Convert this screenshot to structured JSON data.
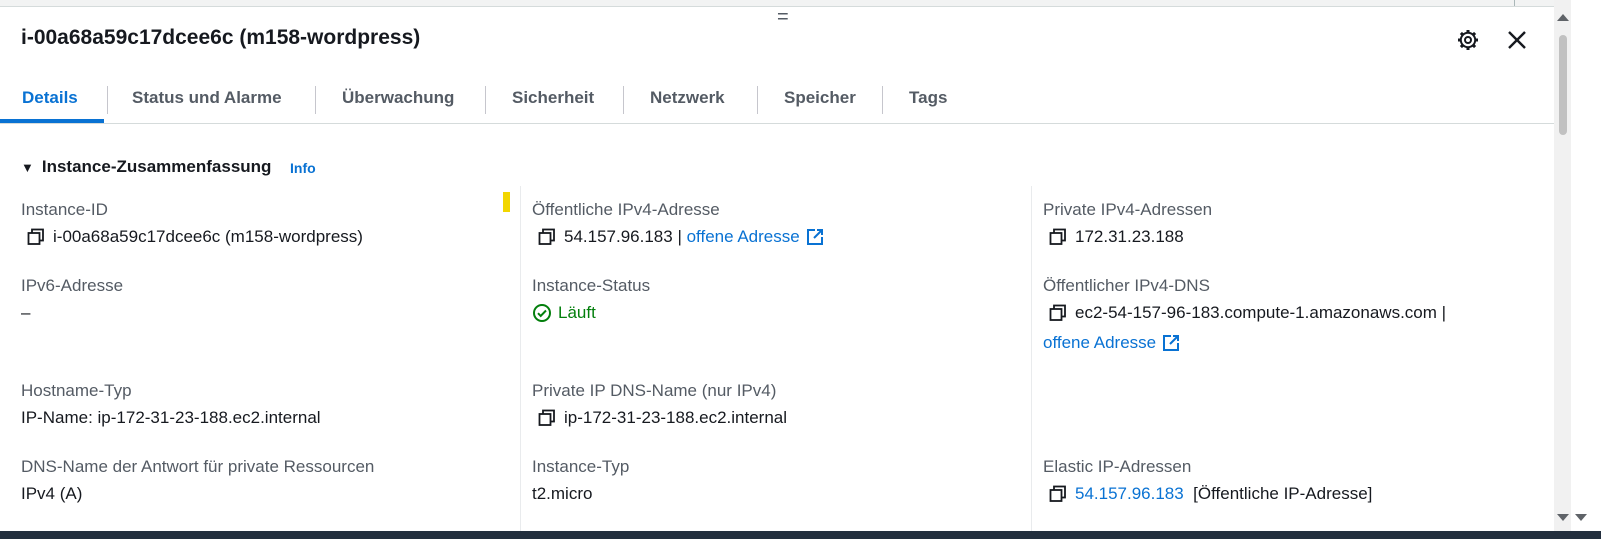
{
  "panel": {
    "title": "i-00a68a59c17dcee6c (m158-wordpress)",
    "drag_handle": "="
  },
  "tabs": [
    {
      "label": "Details"
    },
    {
      "label": "Status und Alarme"
    },
    {
      "label": "Überwachung"
    },
    {
      "label": "Sicherheit"
    },
    {
      "label": "Netzwerk"
    },
    {
      "label": "Speicher"
    },
    {
      "label": "Tags"
    }
  ],
  "section": {
    "title": "Instance-Zusammenfassung",
    "info": "Info"
  },
  "fields": {
    "instance_id": {
      "label": "Instance-ID",
      "value": "i-00a68a59c17dcee6c (m158-wordpress)"
    },
    "public_ipv4": {
      "label": "Öffentliche IPv4-Adresse",
      "value": "54.157.96.183 |",
      "link": "offene Adresse"
    },
    "private_ipv4": {
      "label": "Private IPv4-Adressen",
      "value": "172.31.23.188"
    },
    "ipv6": {
      "label": "IPv6-Adresse",
      "value": "–"
    },
    "instance_status": {
      "label": "Instance-Status",
      "value": "Läuft"
    },
    "public_dns": {
      "label": "Öffentlicher IPv4-DNS",
      "value": "ec2-54-157-96-183.compute-1.amazonaws.com |",
      "link": "offene Adresse"
    },
    "hostname_type": {
      "label": "Hostname-Typ",
      "value": "IP-Name: ip-172-31-23-188.ec2.internal"
    },
    "private_dns": {
      "label": "Private IP DNS-Name (nur IPv4)",
      "value": "ip-172-31-23-188.ec2.internal"
    },
    "dns_answer": {
      "label": "DNS-Name der Antwort für private Ressourcen",
      "value": "IPv4 (A)"
    },
    "instance_type": {
      "label": "Instance-Typ",
      "value": "t2.micro"
    },
    "elastic_ip": {
      "label": "Elastic IP-Adressen",
      "link": "54.157.96.183",
      "value": "[Öffentliche IP-Adresse]"
    }
  },
  "colors": {
    "accent": "#0972d3",
    "success": "#037f0c",
    "label": "#545b64",
    "text": "#16191f"
  },
  "icons": [
    "gear-icon",
    "close-icon",
    "copy-icon",
    "external-link-icon",
    "check-circle-icon",
    "caret-down-icon"
  ]
}
